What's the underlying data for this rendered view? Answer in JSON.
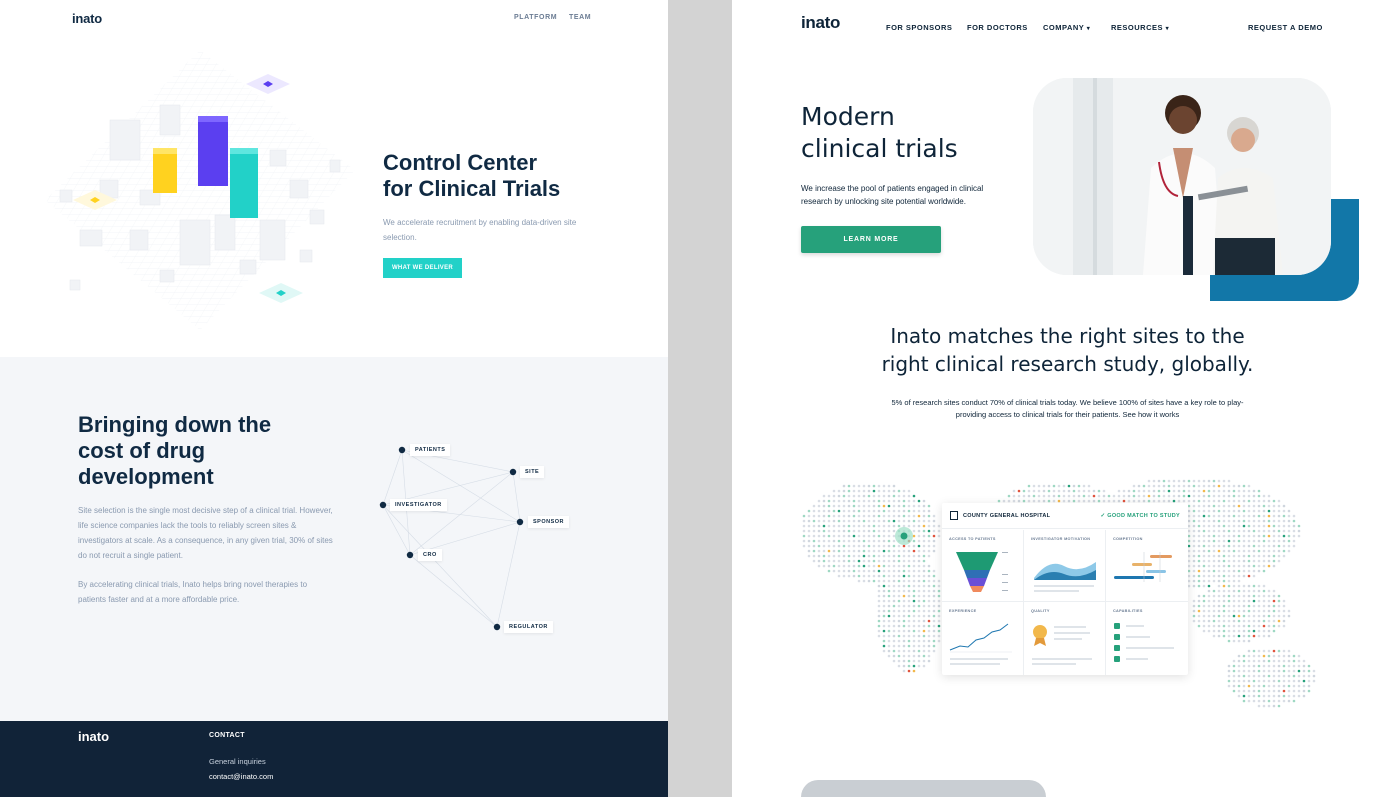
{
  "left_page": {
    "logo": "inato",
    "nav": [
      "PLATFORM",
      "TEAM"
    ],
    "hero": {
      "title_line1": "Control Center",
      "title_line2": "for Clinical Trials",
      "subtitle": "We accelerate recruitment by enabling data-driven site selection.",
      "button": "WHAT WE DELIVER"
    },
    "section2": {
      "title_line1": "Bringing down the",
      "title_line2": "cost of drug",
      "title_line3": "development",
      "p1": "Site selection is the single most decisive step of a clinical trial. However, life science companies lack the tools to reliably screen sites & investigators at scale. As a consequence, in any given trial, 30% of sites do not recruit a single patient.",
      "p2": "By accelerating clinical trials, Inato helps bring novel therapies to patients faster and at a more affordable price."
    },
    "graph_nodes": [
      "PATIENTS",
      "SITE",
      "INVESTIGATOR",
      "SPONSOR",
      "CRO",
      "REGULATOR"
    ],
    "footer": {
      "logo": "inato",
      "contact_heading": "CONTACT",
      "general": "General inquiries",
      "email": "contact@inato.com"
    }
  },
  "right_page": {
    "logo": "inato",
    "nav": {
      "sponsors": "FOR SPONSORS",
      "doctors": "FOR DOCTORS",
      "company": "COMPANY",
      "resources": "RESOURCES",
      "demo": "REQUEST A DEMO"
    },
    "hero": {
      "title_line1": "Modern",
      "title_line2": "clinical trials",
      "subtitle": "We increase the pool of patients engaged in clinical research by unlocking site potential worldwide.",
      "button": "LEARN MORE"
    },
    "match": {
      "title_line1": "Inato matches the right sites to the",
      "title_line2": "right clinical research study, globally.",
      "text": "5% of research sites conduct 70% of clinical trials today. We believe 100% of sites have a key role to play- providing access to clinical trials for their patients. See how it works"
    },
    "card": {
      "hospital": "COUNTY GENERAL HOSPITAL",
      "match": "GOOD MATCH TO STUDY",
      "cells": [
        "ACCESS TO PATIENTS",
        "INVESTIGATOR MOTIVATION",
        "COMPETITION",
        "EXPERIENCE",
        "QUALITY",
        "CAPABILITIES"
      ]
    }
  },
  "colors": {
    "navy": "#102a43",
    "teal": "#22d1c8",
    "green": "#26a17b",
    "blue": "#1277a8",
    "purple": "#5b3ff0",
    "yellow": "#ffd21f"
  }
}
